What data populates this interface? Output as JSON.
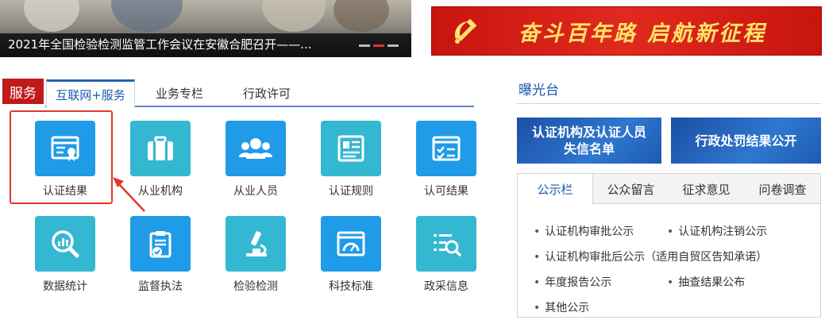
{
  "news": {
    "caption": "2021年全国检验检测监管工作会议在安徽合肥召开——..."
  },
  "slogan": {
    "text": "奋斗百年路 启航新征程"
  },
  "services": {
    "tag": "服务",
    "tabs": [
      {
        "label": "互联网+服务",
        "active": true
      },
      {
        "label": "业务专栏",
        "active": false
      },
      {
        "label": "行政许可",
        "active": false
      }
    ],
    "items": [
      {
        "label": "认证结果",
        "icon": "certificate-icon",
        "color": "#1f9be8"
      },
      {
        "label": "从业机构",
        "icon": "briefcase-icon",
        "color": "#34b7d1"
      },
      {
        "label": "从业人员",
        "icon": "people-icon",
        "color": "#1f9be8"
      },
      {
        "label": "认证规则",
        "icon": "document-rules-icon",
        "color": "#34b7d1"
      },
      {
        "label": "认可结果",
        "icon": "checklist-icon",
        "color": "#1f9be8"
      },
      {
        "label": "数据统计",
        "icon": "magnify-chart-icon",
        "color": "#34b7d1"
      },
      {
        "label": "监督执法",
        "icon": "clipboard-check-icon",
        "color": "#1f9be8"
      },
      {
        "label": "检验检测",
        "icon": "microscope-icon",
        "color": "#34b7d1"
      },
      {
        "label": "科技标准",
        "icon": "gauge-window-icon",
        "color": "#1f9be8"
      },
      {
        "label": "政采信息",
        "icon": "list-search-icon",
        "color": "#34b7d1"
      }
    ]
  },
  "exposure": {
    "title": "曝光台",
    "banners": [
      {
        "line1": "认证机构及认证人员",
        "line2": "失信名单"
      },
      {
        "line1": "行政处罚结果公开",
        "line2": ""
      }
    ],
    "tabs": [
      {
        "label": "公示栏",
        "active": true
      },
      {
        "label": "公众留言",
        "active": false
      },
      {
        "label": "征求意见",
        "active": false
      },
      {
        "label": "问卷调查",
        "active": false
      }
    ],
    "links": [
      "认证机构审批公示",
      "认证机构注销公示",
      "认证机构审批后公示（适用自贸区告知承诺）",
      "年度报告公示",
      "抽查结果公布",
      "其他公示"
    ]
  }
}
